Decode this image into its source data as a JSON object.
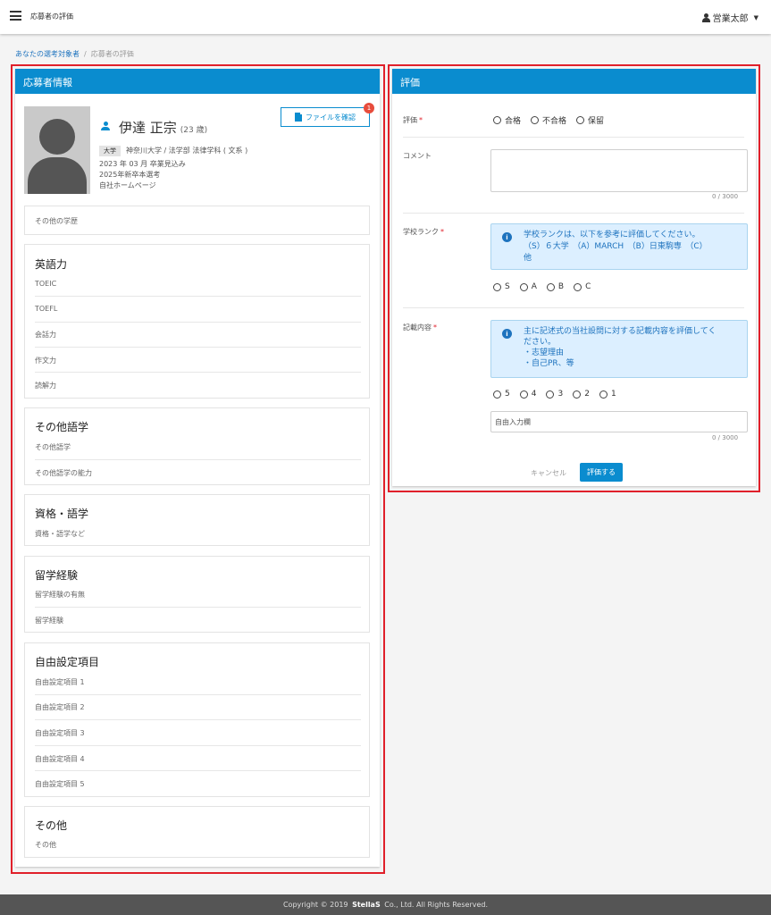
{
  "topbar": {
    "title": "応募者の評価",
    "user_name": "営業太郎"
  },
  "breadcrumb": {
    "parent": "あなたの選考対象者",
    "current": "応募者の評価"
  },
  "applicant": {
    "panel_title": "応募者情報",
    "name": "伊達 正宗",
    "age": "(23 歳)",
    "file_button": "ファイルを確認",
    "file_badge": "1",
    "school_tag": "大学",
    "school": "神奈川大学 / 法学部 法律学科 ( 文系 )",
    "graduation": "2023 年 03 月 卒業見込み",
    "selection": "2025年新卒本選考",
    "source": "自社ホームページ",
    "other_education": "その他の学歴",
    "english": {
      "title": "英語力",
      "rows": [
        "TOEIC",
        "TOEFL",
        "会話力",
        "作文力",
        "読解力"
      ]
    },
    "other_language": {
      "title": "その他語学",
      "rows": [
        "その他語学",
        "その他語学の能力"
      ]
    },
    "qualification": {
      "title": "資格・語学",
      "rows": [
        "資格・語学など"
      ]
    },
    "study_abroad": {
      "title": "留学経験",
      "rows": [
        "留学経験の有無",
        "留学経験"
      ]
    },
    "custom": {
      "title": "自由設定項目",
      "rows": [
        "自由設定項目 1",
        "自由設定項目 2",
        "自由設定項目 3",
        "自由設定項目 4",
        "自由設定項目 5"
      ]
    },
    "other": {
      "title": "その他",
      "rows": [
        "その他"
      ]
    }
  },
  "evaluation": {
    "panel_title": "評価",
    "rating": {
      "label": "評価",
      "required": "*",
      "options": [
        "合格",
        "不合格",
        "保留"
      ]
    },
    "comment": {
      "label": "コメント",
      "counter": "0 / 3000",
      "value": ""
    },
    "school_rank": {
      "label": "学校ランク",
      "required": "*",
      "info_line1": "学校ランクは、以下を参考に評価してください。",
      "info_line2": "（S）６大学　（A）MARCH　（B）日東駒専　（C）",
      "info_line3": "他",
      "options": [
        "S",
        "A",
        "B",
        "C"
      ]
    },
    "content": {
      "label": "記載内容",
      "required": "*",
      "info_line1": "主に記述式の当社設問に対する記載内容を評価してく",
      "info_line2": "ださい。",
      "info_line3": "・志望理由",
      "info_line4": "・自己PR、等",
      "options": [
        "5",
        "4",
        "3",
        "2",
        "1"
      ],
      "free_input": "自由入力欄",
      "counter": "0 / 3000"
    },
    "cancel": "キャンセル",
    "submit": "評価する"
  },
  "footer": {
    "prefix": "Copyright © 2019",
    "brand": "StellaS",
    "suffix": "Co., Ltd. All Rights Reserved."
  },
  "colors": {
    "primary": "#0a8ccf",
    "highlight_outline": "#e0202a",
    "badge": "#e74c3c"
  }
}
